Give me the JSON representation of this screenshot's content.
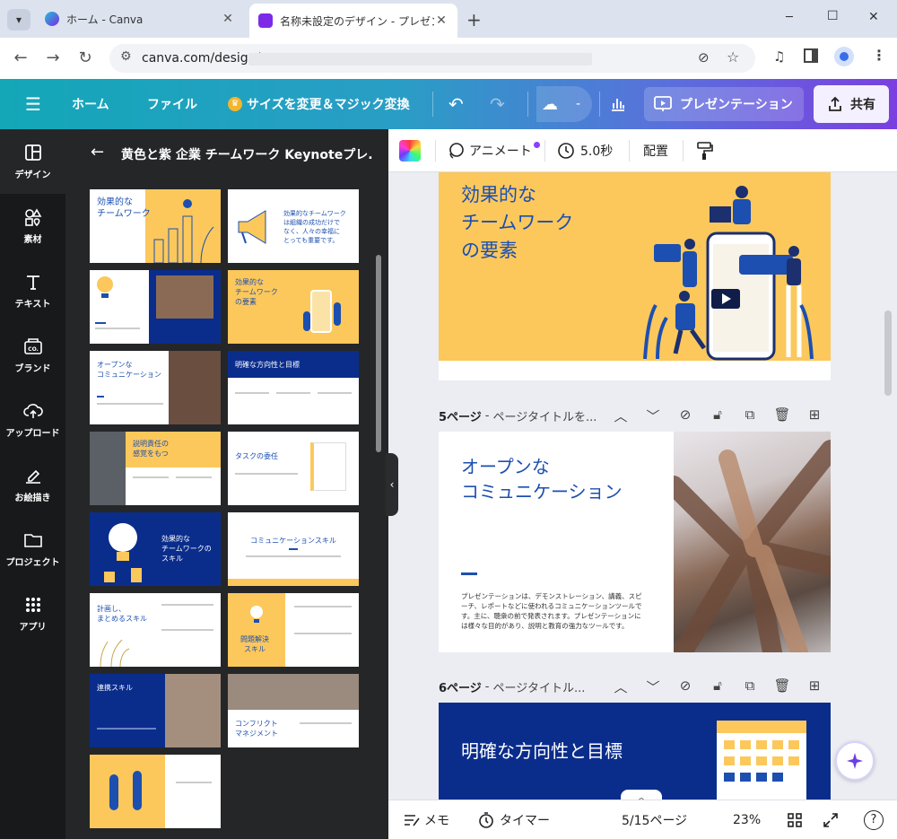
{
  "browser": {
    "tabs": [
      {
        "title": "ホーム - Canva",
        "active": false
      },
      {
        "title": "名称未設定のデザイン - プレゼンテ",
        "active": true
      }
    ],
    "new_tab": "+",
    "url": "canva.com/design/",
    "window_controls": {
      "minimize": "─",
      "maximize": "☐",
      "close": "✕"
    }
  },
  "header": {
    "menu": "☰",
    "home": "ホーム",
    "file": "ファイル",
    "resize": "サイズを変更＆マジック変換",
    "present": "プレゼンテーション",
    "share": "共有",
    "more": "-"
  },
  "rail": {
    "items": [
      {
        "label": "デザイン",
        "icon": "design-icon"
      },
      {
        "label": "素材",
        "icon": "elements-icon"
      },
      {
        "label": "テキスト",
        "icon": "text-icon"
      },
      {
        "label": "ブランド",
        "icon": "brand-icon"
      },
      {
        "label": "アップロード",
        "icon": "upload-icon"
      },
      {
        "label": "お絵描き",
        "icon": "draw-icon"
      },
      {
        "label": "プロジェクト",
        "icon": "folder-icon"
      },
      {
        "label": "アプリ",
        "icon": "apps-icon"
      }
    ]
  },
  "panel": {
    "back": "←",
    "title": "黄色と紫 企業 チームワーク Keynoteプレ...",
    "thumbs": [
      {
        "title": "効果的な\nチームワーク",
        "style": "title-yellow"
      },
      {
        "title": "効果的なチームワーク\nは組織の成功だけで\nなく、人々の幸福に\nとっても重要です。",
        "style": "quote-megaphone"
      },
      {
        "title": "",
        "style": "bulb-photo"
      },
      {
        "title": "効果的な\nチームワーク\nの要素",
        "style": "yellow-phone"
      },
      {
        "title": "オープンな\nコミュニケーション",
        "style": "white-photo"
      },
      {
        "title": "明確な方向性と目標",
        "style": "blue-columns"
      },
      {
        "title": "説明責任の\n感覚をもつ",
        "style": "photo-yellow"
      },
      {
        "title": "タスクの委任",
        "style": "white-doc"
      },
      {
        "title": "効果的な\nチームワークの\nスキル",
        "style": "blue-bulb"
      },
      {
        "title": "コミュニケーションスキル",
        "style": "white-center"
      },
      {
        "title": "計画し、\nまとめるスキル",
        "style": "white-plants"
      },
      {
        "title": "問題解決\nスキル",
        "style": "yellow-bulb"
      },
      {
        "title": "連携スキル",
        "style": "blue-photo"
      },
      {
        "title": "コンフリクト\nマネジメント",
        "style": "photo-white"
      },
      {
        "title": "",
        "style": "yellow-people"
      }
    ]
  },
  "toolbar": {
    "animate": "アニメート",
    "duration": "5.0秒",
    "position": "配置"
  },
  "editor": {
    "slide4": {
      "title": "効果的な\nチームワーク\nの要素"
    },
    "page5": {
      "label": "5ページ",
      "title": "ページタイトルを..."
    },
    "slide5": {
      "title": "オープンな\nコミュニケーション",
      "body": "プレゼンテーションは、デモンストレーション、講義、スピーチ、レポートなどに使われるコミュニケーションツールです。主に、聴衆の前で発表されます。プレゼンテーションには様々な目的があり、説明と教育の強力なツールです。"
    },
    "page6": {
      "label": "6ページ",
      "title": "ページタイトル..."
    },
    "slide6": {
      "title": "明確な方向性と目標"
    }
  },
  "bottombar": {
    "notes": "メモ",
    "timer": "タイマー",
    "pages": "5/15ページ",
    "zoom": "23%",
    "help": "?"
  },
  "colors": {
    "canva_blue": "#1c4fb0",
    "slide_yellow": "#fcc85c",
    "dark_navy": "#0a2d8c"
  }
}
